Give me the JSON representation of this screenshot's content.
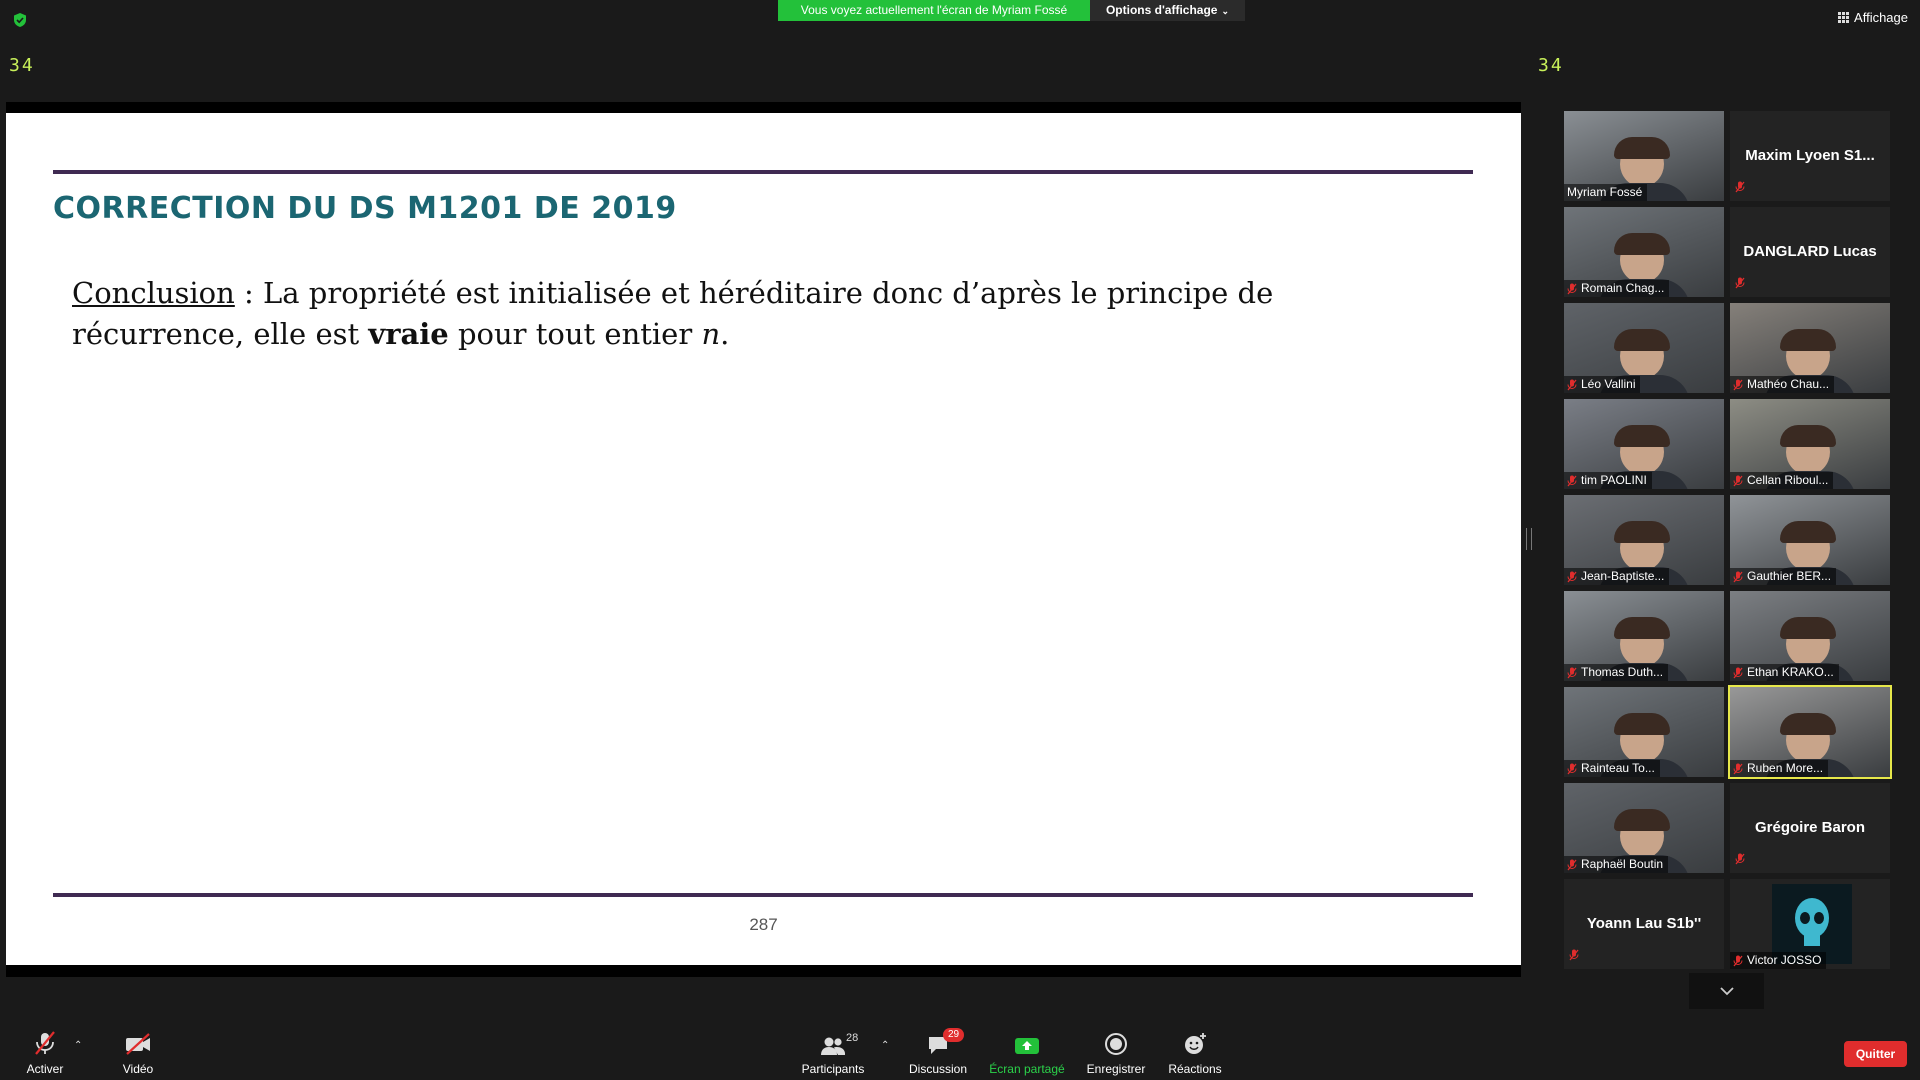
{
  "top_bar": {
    "banner": "Vous voyez actuellement l'écran de Myriam Fossé",
    "view_options": "Options d'affichage",
    "view_button": "Affichage",
    "counter_left": "34",
    "counter_right": "34"
  },
  "slide": {
    "title": "CORRECTION DU DS M1201 DE 2019",
    "conclusion_label": "Conclusion",
    "body_part1": " : La propriété est initialisée et héréditaire donc d’après le principe de récurrence, elle est ",
    "body_bold": "vraie",
    "body_part2": " pour tout entier ",
    "body_var": "n",
    "body_end": ".",
    "page_number": "287"
  },
  "participants": [
    {
      "name": "Myriam Fossé",
      "kind": "video",
      "muted": false
    },
    {
      "name": "Maxim  Lyoen  S1...",
      "kind": "name",
      "muted": true
    },
    {
      "name": "Romain Chag...",
      "kind": "video",
      "muted": true
    },
    {
      "name": "DANGLARD Lucas",
      "kind": "name",
      "muted": true
    },
    {
      "name": "Léo Vallini",
      "kind": "video",
      "muted": true
    },
    {
      "name": "Mathéo Chau...",
      "kind": "video",
      "muted": true
    },
    {
      "name": "tim PAOLINI",
      "kind": "video",
      "muted": true
    },
    {
      "name": "Cellan Riboul...",
      "kind": "video",
      "muted": true
    },
    {
      "name": "Jean-Baptiste...",
      "kind": "video",
      "muted": true
    },
    {
      "name": "Gauthier BER...",
      "kind": "video",
      "muted": true
    },
    {
      "name": "Thomas Duth...",
      "kind": "video",
      "muted": true
    },
    {
      "name": "Ethan KRAKO...",
      "kind": "video",
      "muted": true
    },
    {
      "name": "Rainteau To...",
      "kind": "video",
      "muted": true
    },
    {
      "name": "Ruben More...",
      "kind": "video",
      "muted": true,
      "active": true
    },
    {
      "name": "Raphaël Boutin",
      "kind": "video",
      "muted": true
    },
    {
      "name": "Grégoire Baron",
      "kind": "name",
      "muted": true
    },
    {
      "name": "Yoann Lau S1b''",
      "kind": "name",
      "muted": true
    },
    {
      "name": "Victor JOSSO",
      "kind": "avatar",
      "muted": true
    }
  ],
  "toolbar": {
    "mute_label": "Activer",
    "video_label": "Vidéo",
    "participants_label": "Participants",
    "participants_count": "28",
    "chat_label": "Discussion",
    "chat_badge": "29",
    "share_label": "Écran partagé",
    "record_label": "Enregistrer",
    "reactions_label": "Réactions",
    "quit_label": "Quitter"
  },
  "colors": {
    "banner_green": "#23c13a",
    "slide_title": "#1b6672",
    "slide_rule": "#3f2a52",
    "active_speaker": "#e7e84a",
    "quit_red": "#e02d2d",
    "counter": "#c8f05a"
  }
}
